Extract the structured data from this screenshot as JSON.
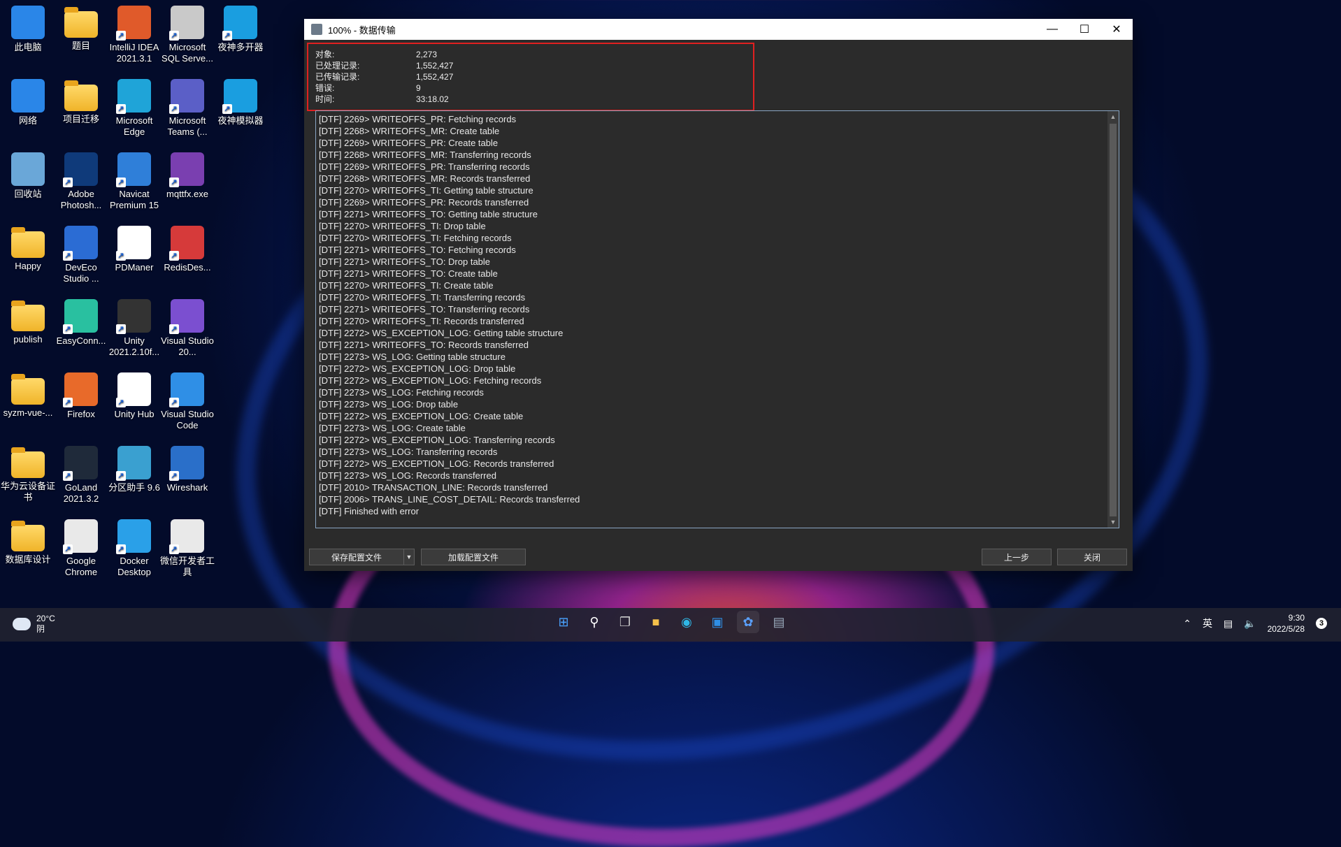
{
  "desktop": {
    "icons": [
      {
        "label": "此电脑"
      },
      {
        "label": "题目"
      },
      {
        "label": "IntelliJ IDEA 2021.3.1"
      },
      {
        "label": "Microsoft SQL Serve..."
      },
      {
        "label": "夜神多开器"
      },
      {
        "label": "网络"
      },
      {
        "label": "项目迁移"
      },
      {
        "label": "Microsoft Edge"
      },
      {
        "label": "Microsoft Teams (..."
      },
      {
        "label": "夜神模拟器"
      },
      {
        "label": "回收站"
      },
      {
        "label": "Adobe Photosh..."
      },
      {
        "label": "Navicat Premium 15"
      },
      {
        "label": "mqttfx.exe"
      },
      {
        "label": "Happy"
      },
      {
        "label": "DevEco Studio ..."
      },
      {
        "label": "PDManer"
      },
      {
        "label": "RedisDes..."
      },
      {
        "label": "publish"
      },
      {
        "label": "EasyConn..."
      },
      {
        "label": "Unity 2021.2.10f..."
      },
      {
        "label": "Visual Studio 20..."
      },
      {
        "label": "syzm-vue-..."
      },
      {
        "label": "Firefox"
      },
      {
        "label": "Unity Hub"
      },
      {
        "label": "Visual Studio Code"
      },
      {
        "label": "华为云设备证书"
      },
      {
        "label": "GoLand 2021.3.2"
      },
      {
        "label": "分区助手 9.6"
      },
      {
        "label": "Wireshark"
      },
      {
        "label": "数据库设计"
      },
      {
        "label": "Google Chrome"
      },
      {
        "label": "Docker Desktop"
      },
      {
        "label": "微信开发者工具"
      }
    ]
  },
  "window": {
    "title": "100% - 数据传输",
    "stats": [
      {
        "key": "对象:",
        "value": "2,273"
      },
      {
        "key": "已处理记录:",
        "value": "1,552,427"
      },
      {
        "key": "已传输记录:",
        "value": "1,552,427"
      },
      {
        "key": "错误:",
        "value": "9"
      },
      {
        "key": "时间:",
        "value": "33:18.02"
      }
    ],
    "log": [
      "[DTF] 2269> WRITEOFFS_PR: Fetching records",
      "[DTF] 2268> WRITEOFFS_MR: Create table",
      "[DTF] 2269> WRITEOFFS_PR: Create table",
      "[DTF] 2268> WRITEOFFS_MR: Transferring records",
      "[DTF] 2269> WRITEOFFS_PR: Transferring records",
      "[DTF] 2268> WRITEOFFS_MR: Records transferred",
      "[DTF] 2270> WRITEOFFS_TI: Getting table structure",
      "[DTF] 2269> WRITEOFFS_PR: Records transferred",
      "[DTF] 2271> WRITEOFFS_TO: Getting table structure",
      "[DTF] 2270> WRITEOFFS_TI: Drop table",
      "[DTF] 2270> WRITEOFFS_TI: Fetching records",
      "[DTF] 2271> WRITEOFFS_TO: Fetching records",
      "[DTF] 2271> WRITEOFFS_TO: Drop table",
      "[DTF] 2271> WRITEOFFS_TO: Create table",
      "[DTF] 2270> WRITEOFFS_TI: Create table",
      "[DTF] 2270> WRITEOFFS_TI: Transferring records",
      "[DTF] 2271> WRITEOFFS_TO: Transferring records",
      "[DTF] 2270> WRITEOFFS_TI: Records transferred",
      "[DTF] 2272> WS_EXCEPTION_LOG: Getting table structure",
      "[DTF] 2271> WRITEOFFS_TO: Records transferred",
      "[DTF] 2273> WS_LOG: Getting table structure",
      "[DTF] 2272> WS_EXCEPTION_LOG: Drop table",
      "[DTF] 2272> WS_EXCEPTION_LOG: Fetching records",
      "[DTF] 2273> WS_LOG: Fetching records",
      "[DTF] 2273> WS_LOG: Drop table",
      "[DTF] 2272> WS_EXCEPTION_LOG: Create table",
      "[DTF] 2273> WS_LOG: Create table",
      "[DTF] 2272> WS_EXCEPTION_LOG: Transferring records",
      "[DTF] 2273> WS_LOG: Transferring records",
      "[DTF] 2272> WS_EXCEPTION_LOG: Records transferred",
      "[DTF] 2273> WS_LOG: Records transferred",
      "[DTF] 2010> TRANSACTION_LINE: Records transferred",
      "[DTF] 2006> TRANS_LINE_COST_DETAIL: Records transferred",
      "[DTF] Finished with error"
    ],
    "buttons": {
      "save_config": "保存配置文件",
      "load_config": "加载配置文件",
      "back": "上一步",
      "close": "关闭"
    }
  },
  "taskbar": {
    "weather_temp": "20°C",
    "weather_desc": "阴",
    "ime": "英",
    "time": "9:30",
    "date": "2022/5/28",
    "notifications": "3"
  }
}
